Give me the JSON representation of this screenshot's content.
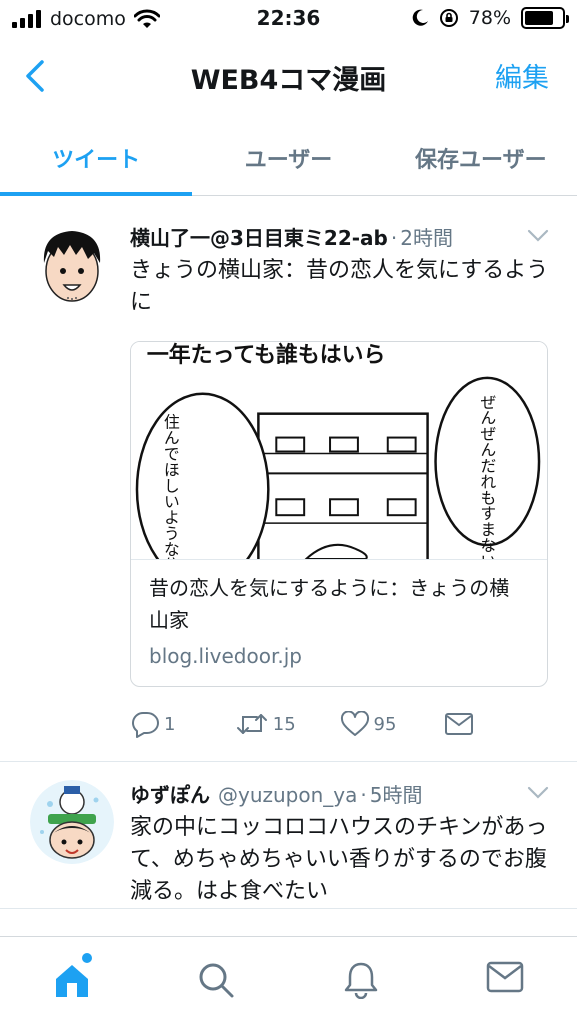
{
  "status_bar": {
    "carrier": "docomo",
    "time": "22:36",
    "battery": "78%",
    "battery_level": 0.78
  },
  "nav": {
    "title": "WEB4コマ漫画",
    "edit_label": "編集"
  },
  "tabs": [
    {
      "label": "ツイート",
      "active": true
    },
    {
      "label": "ユーザー",
      "active": false
    },
    {
      "label": "保存ユーザー",
      "active": false
    }
  ],
  "tweets": [
    {
      "display_name": "横山了一@3日目東ミ22-ab",
      "time": "2時間",
      "text": "きょうの横山家：昔の恋人を気にするように",
      "card": {
        "image_text": {
          "top": "一年たっても誰もはいら",
          "left": "住んでほしいような住んでほしくないような…",
          "right": "ぜんぜんだれもすまないね…"
        },
        "title": "昔の恋人を気にするように：きょうの横山家",
        "domain": "blog.livedoor.jp"
      },
      "replies": "1",
      "retweets": "15",
      "likes": "95"
    },
    {
      "display_name": "ゆずぽん",
      "handle": "@yuzupon_ya",
      "time": "5時間",
      "text": "家の中にコッコロコハウスのチキンがあって、めちゃめちゃいい香りがするのでお腹減る。はよ食べたい"
    }
  ],
  "colors": {
    "accent": "#1da1f2",
    "muted": "#657786",
    "text": "#14171a"
  },
  "icons": {
    "bottom_tabs": [
      "home-icon",
      "search-icon",
      "notifications-icon",
      "messages-icon"
    ]
  }
}
